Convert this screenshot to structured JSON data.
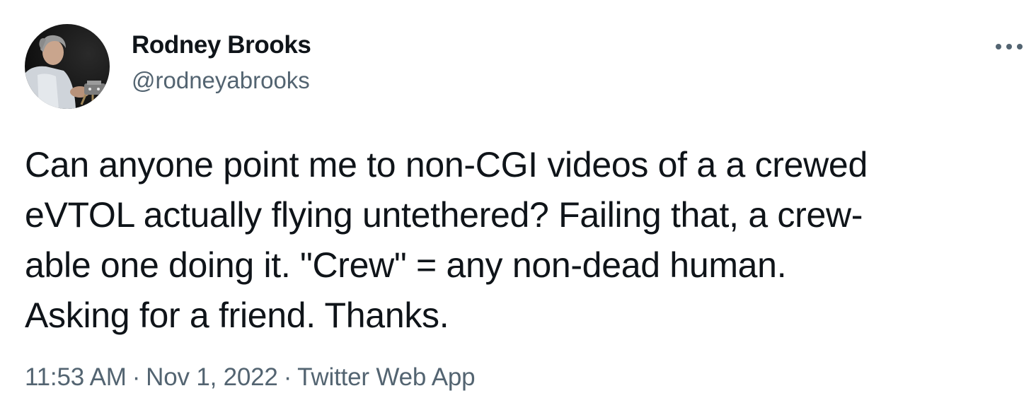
{
  "author": {
    "display_name": "Rodney Brooks",
    "handle": "@rodneyabrooks",
    "avatar_icon": "profile-photo"
  },
  "more_icon": "more-horizontal-icon",
  "tweet": {
    "lines": [
      "Can anyone point me to non-CGI videos of a a crewed",
      "eVTOL actually flying untethered? Failing that, a crew-",
      "able one doing it. \"Crew\" = any non-dead human.",
      "Asking for a friend. Thanks."
    ]
  },
  "meta": {
    "time": "11:53 AM",
    "separator": "·",
    "date": "Nov 1, 2022",
    "source": "Twitter Web App"
  },
  "colors": {
    "text": "#0f1419",
    "secondary": "#536471"
  }
}
